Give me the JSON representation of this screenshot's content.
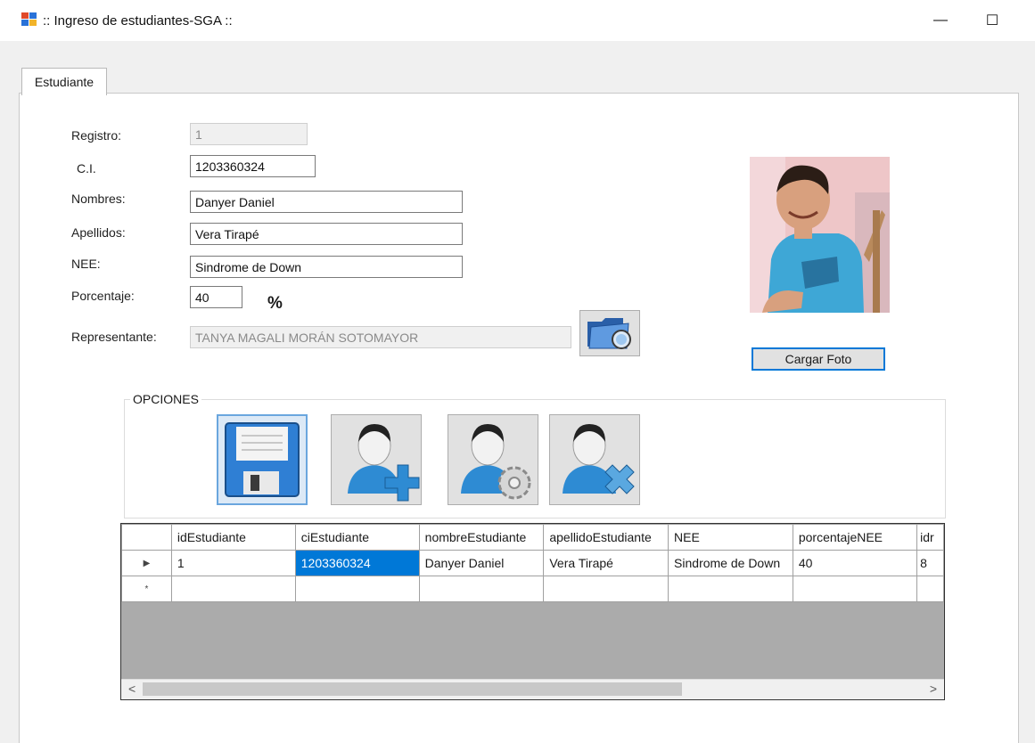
{
  "window": {
    "title": ":: Ingreso de estudiantes-SGA ::",
    "minimize_glyph": "—",
    "maximize_glyph": "☐"
  },
  "tabs": [
    {
      "label": "Estudiante"
    }
  ],
  "form": {
    "registro": {
      "label": "Registro:",
      "value": "1"
    },
    "ci": {
      "label": "C.I.",
      "value": "1203360324"
    },
    "nombres": {
      "label": "Nombres:",
      "value": "Danyer Daniel"
    },
    "apellidos": {
      "label": "Apellidos:",
      "value": "Vera Tirapé"
    },
    "nee": {
      "label": "NEE:",
      "value": "Sindrome de Down"
    },
    "porcentaje": {
      "label": "Porcentaje:",
      "value": "40",
      "suffix": "%"
    },
    "representante": {
      "label": "Representante:",
      "value": "TANYA MAGALI MORÁN SOTOMAYOR"
    }
  },
  "photo": {
    "button_label": "Cargar Foto"
  },
  "options": {
    "legend": "OPCIONES",
    "buttons": [
      {
        "icon": "save-icon"
      },
      {
        "icon": "add-user-icon"
      },
      {
        "icon": "edit-user-icon"
      },
      {
        "icon": "delete-user-icon"
      }
    ]
  },
  "grid": {
    "columns": [
      "idEstudiante",
      "ciEstudiante",
      "nombreEstudiante",
      "apellidoEstudiante",
      "NEE",
      "porcentajeNEE",
      "idr"
    ],
    "rows": [
      {
        "marker": "▶",
        "cells": [
          "1",
          "1203360324",
          "Danyer Daniel",
          "Vera Tirapé",
          "Sindrome de Down",
          "40",
          "8"
        ]
      }
    ],
    "new_row_marker": "*",
    "scroll_left": "<",
    "scroll_right": ">"
  },
  "colors": {
    "accent": "#0078d7",
    "window_bg": "#f0f0f0",
    "grid_empty": "#ababab"
  }
}
